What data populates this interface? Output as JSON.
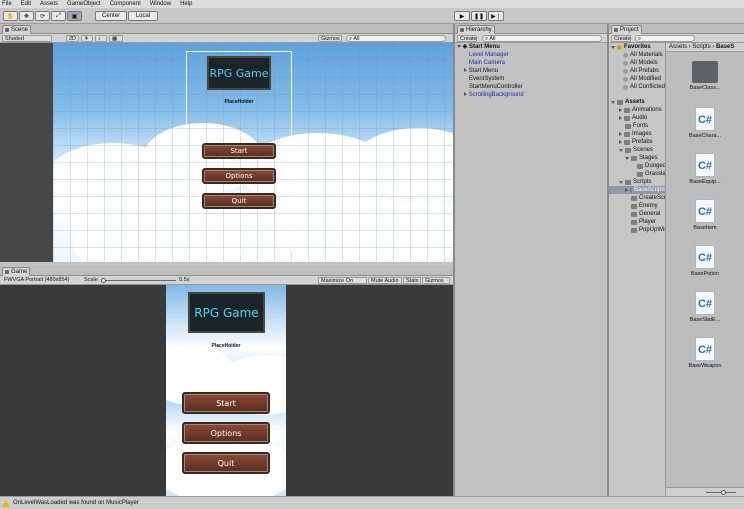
{
  "menu": [
    "File",
    "Edit",
    "Assets",
    "GameObject",
    "Component",
    "Window",
    "Help"
  ],
  "toolbar": {
    "pivot_label": "Center",
    "space_label": "Local",
    "tools": [
      "hand-tool-icon",
      "move-tool-icon",
      "rotate-tool-icon",
      "scale-tool-icon",
      "rect-tool-icon"
    ],
    "play": [
      "play-icon",
      "pause-icon",
      "step-icon"
    ]
  },
  "scene": {
    "tab": "Scene",
    "shading": "Shaded",
    "mode2d": "2D",
    "gizmos": "Gizmos",
    "search": "All"
  },
  "game": {
    "tab": "Game",
    "aspect": "FWVGA Portrait (480x854)",
    "scale_label": "Scale",
    "scale_value": "0.5x",
    "maximize": "Maximize On Play",
    "mute": "Mute Audio",
    "stats": "Stats",
    "gizmos": "Gizmos"
  },
  "ui": {
    "title": "RPG Game",
    "placeholder": "PlaceHolder",
    "buttons": [
      "Start",
      "Options",
      "Quit"
    ]
  },
  "hierarchy": {
    "tab": "Hierarchy",
    "create": "Create",
    "search": "All",
    "scene": "Start Menu",
    "items": [
      "Level Manager",
      "Main Camera",
      "Start Menu",
      "EventSystem",
      "StartMenuController",
      "ScrollingBackground"
    ]
  },
  "project": {
    "tab": "Project",
    "create": "Create",
    "favorites_label": "Favorites",
    "favorites": [
      "All Materials",
      "All Models",
      "All Prefabs",
      "All Modified",
      "All Conflicted"
    ],
    "assets_label": "Assets",
    "tree": [
      "Animations",
      "Audio",
      "Fonts",
      "Images",
      "Prefabs",
      "Scenes",
      "Stages",
      "Dungeon",
      "Grassland",
      "Scripts",
      "BaseScripts",
      "CreateScripts",
      "Enemy",
      "General",
      "Player",
      "PopUpWindow"
    ],
    "breadcrumb": [
      "Assets",
      "Scripts",
      "BaseS"
    ],
    "files": [
      "BaseClass...",
      "BaseChara...",
      "BaseEquip...",
      "BaseItem",
      "BasePotion",
      "BaseStatE...",
      "BaseWeapon"
    ]
  },
  "console": {
    "message": "OnLevelWasLoaded was found on MusicPlayer",
    "status_color": "#e6b800"
  }
}
